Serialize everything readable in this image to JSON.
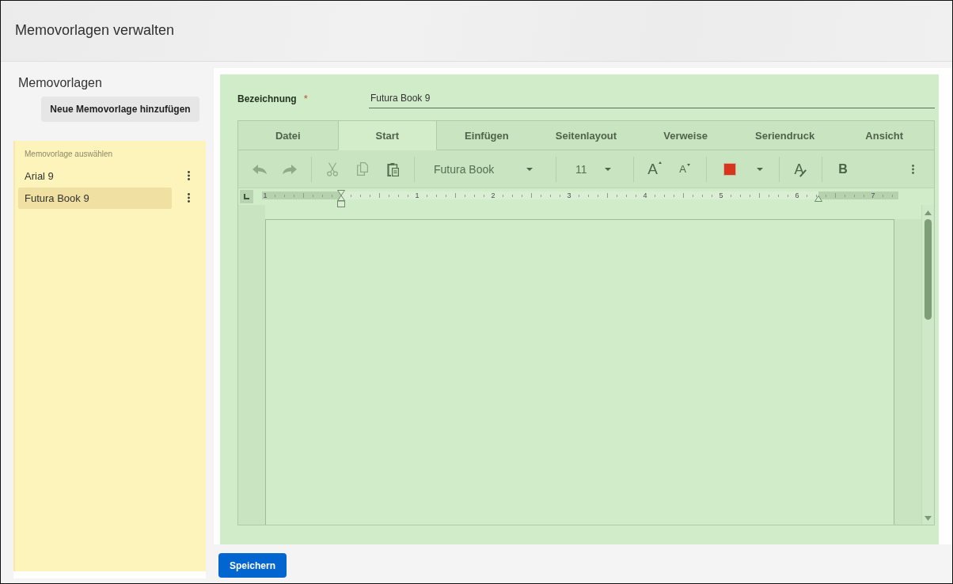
{
  "window": {
    "title": "Memovorlagen verwalten"
  },
  "sidebar": {
    "title": "Memovorlagen",
    "add_button": "Neue Memovorlage hinzufügen",
    "list_caption": "Memovorlage auswählen",
    "items": [
      {
        "label": "Arial 9",
        "selected": false
      },
      {
        "label": "Futura Book 9",
        "selected": true
      }
    ]
  },
  "editor": {
    "name_field": {
      "label": "Bezeichnung",
      "required_mark": "*",
      "value": "Futura Book 9"
    },
    "tabs": [
      {
        "label": "Datei",
        "selected": false
      },
      {
        "label": "Start",
        "selected": true
      },
      {
        "label": "Einfügen",
        "selected": false
      },
      {
        "label": "Seitenlayout",
        "selected": false
      },
      {
        "label": "Verweise",
        "selected": false
      },
      {
        "label": "Seriendruck",
        "selected": false
      },
      {
        "label": "Ansicht",
        "selected": false
      }
    ],
    "toolbar": {
      "history": [
        {
          "kind": "undo",
          "disabled": true
        },
        {
          "kind": "redo",
          "disabled": true
        }
      ],
      "clipboard": [
        {
          "kind": "cut",
          "disabled": true
        },
        {
          "kind": "copy",
          "disabled": true
        },
        {
          "kind": "paste",
          "disabled": false
        }
      ],
      "font": "Futura Book",
      "font_size": "11",
      "grow_font": "A",
      "shrink_font": "A",
      "font_color": {
        "color": "#d7361c"
      },
      "clear_format": "A",
      "bold": "B"
    },
    "ruler": {
      "labels": [
        "1",
        "1",
        "2",
        "3",
        "4",
        "5",
        "6",
        "7"
      ]
    }
  },
  "save_button": "Speichern"
}
